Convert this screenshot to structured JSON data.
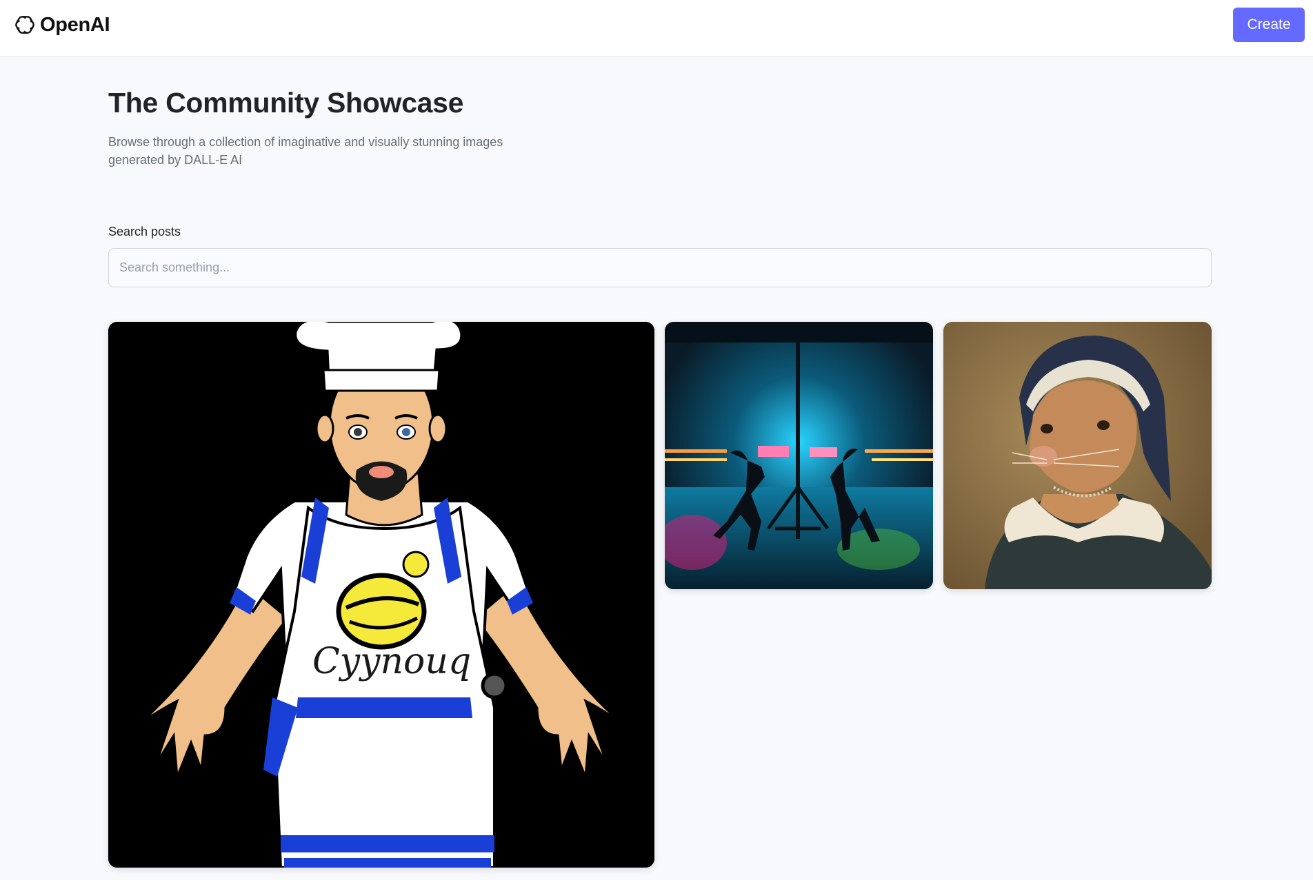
{
  "header": {
    "logo_text": "OpenAI",
    "logo_icon": "openai-logo-icon",
    "create_label": "Create",
    "accent_color": "#6469ff"
  },
  "main": {
    "title": "The Community Showcase",
    "subtitle": "Browse through a collection of imaginative and visually stunning images generated by DALL-E AI"
  },
  "search": {
    "label": "Search posts",
    "value": "",
    "placeholder": "Search something..."
  },
  "posts": [
    {
      "image": "cartoon-chef-image",
      "apron_text": "Cyynouq"
    },
    {
      "image": "neon-fighters-image"
    },
    {
      "image": "renaissance-animal-portrait-image"
    }
  ]
}
